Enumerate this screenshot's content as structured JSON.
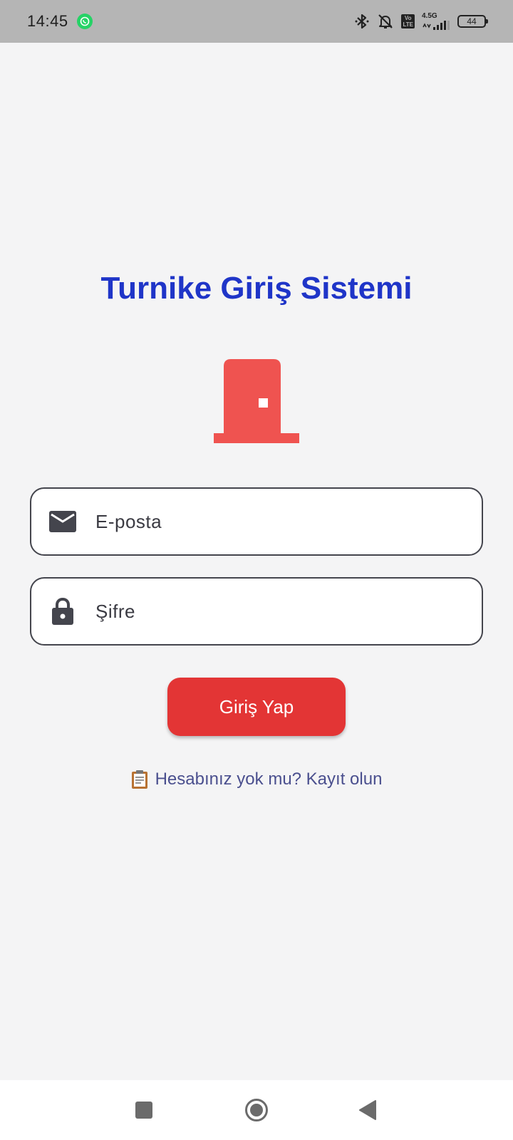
{
  "status_bar": {
    "time": "14:45",
    "network_label": "4.5G",
    "volte_label": "Vo\nLTE",
    "battery_level": "44",
    "icons": [
      "whatsapp-icon",
      "bluetooth-icon",
      "bell-off-icon",
      "volte-icon",
      "signal-icon",
      "battery-icon"
    ]
  },
  "main": {
    "title": "Turnike Giriş Sistemi",
    "logo_icon": "door-icon",
    "email": {
      "placeholder": "E-posta",
      "value": "",
      "icon": "mail-icon"
    },
    "password": {
      "placeholder": "Şifre",
      "value": "",
      "icon": "lock-icon"
    },
    "login_label": "Giriş Yap",
    "register_text": "Hesabınız yok mu? Kayıt olun",
    "register_icon": "clipboard-icon"
  },
  "navigation": {
    "items": [
      "recents-button",
      "home-button",
      "back-button"
    ]
  },
  "colors": {
    "title": "#1f35c8",
    "accent": "#e33535",
    "door": "#ef5350",
    "link": "#4a4f8e",
    "background": "#f4f4f5",
    "status_bar": "#b5b5b5"
  }
}
